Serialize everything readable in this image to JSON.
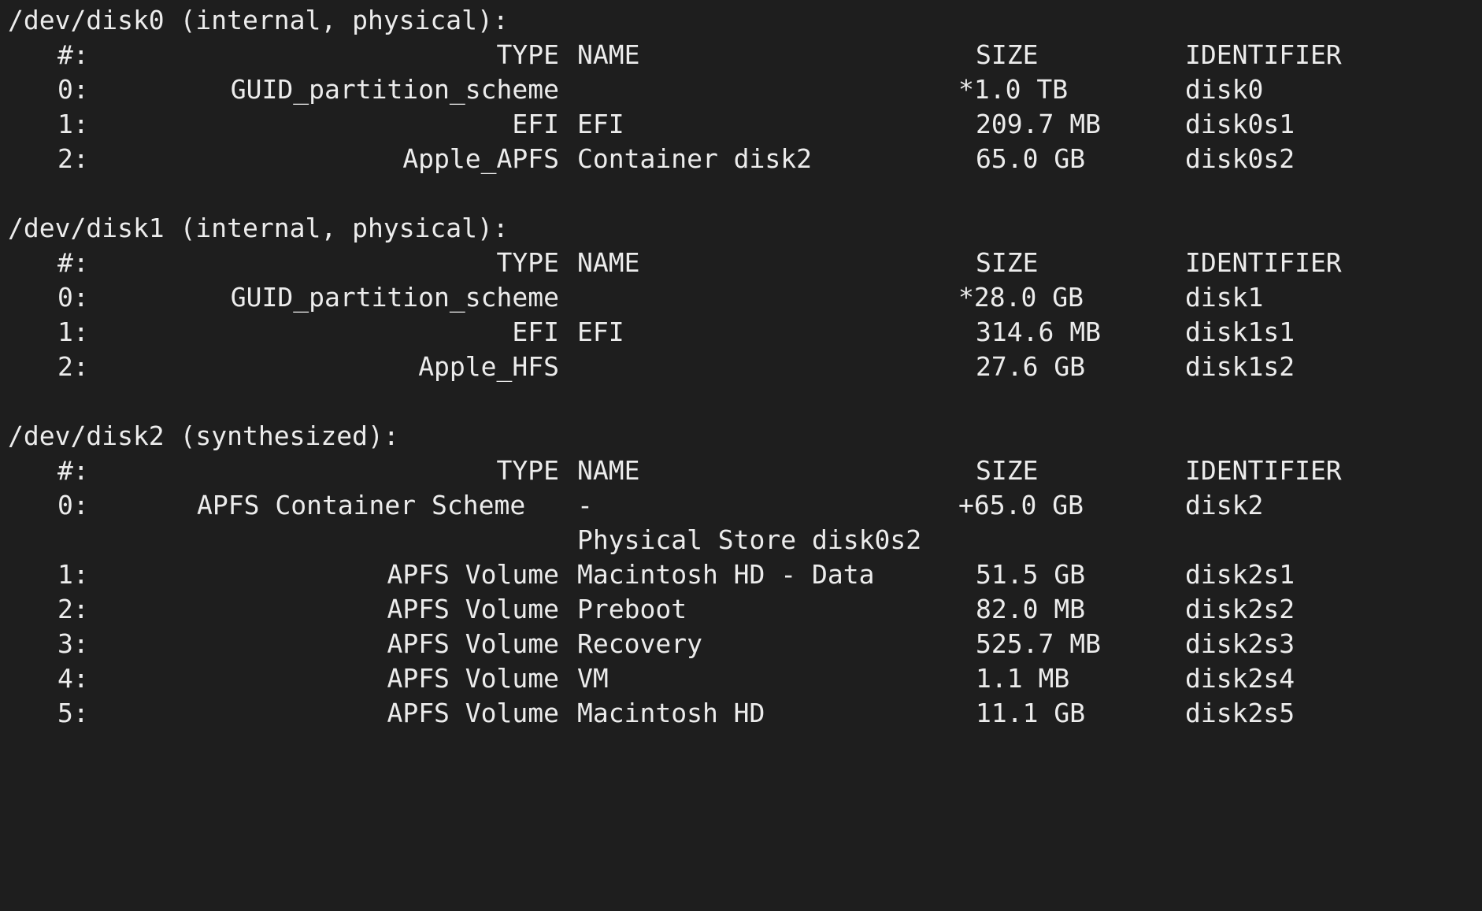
{
  "terminal": {
    "disks": [
      {
        "header": "/dev/disk0 (internal, physical):",
        "columns": {
          "num": "#:",
          "type": "TYPE",
          "name": "NAME",
          "size": "SIZE",
          "identifier": "IDENTIFIER"
        },
        "rows": [
          {
            "num": "0:",
            "type": "GUID_partition_scheme",
            "name": "",
            "size": "*1.0 TB",
            "identifier": "disk0"
          },
          {
            "num": "1:",
            "type": "EFI",
            "name": "EFI",
            "size": "209.7 MB",
            "identifier": "disk0s1"
          },
          {
            "num": "2:",
            "type": "Apple_APFS",
            "name": "Container disk2",
            "size": "65.0 GB",
            "identifier": "disk0s2"
          }
        ]
      },
      {
        "header": "/dev/disk1 (internal, physical):",
        "columns": {
          "num": "#:",
          "type": "TYPE",
          "name": "NAME",
          "size": "SIZE",
          "identifier": "IDENTIFIER"
        },
        "rows": [
          {
            "num": "0:",
            "type": "GUID_partition_scheme",
            "name": "",
            "size": "*28.0 GB",
            "identifier": "disk1"
          },
          {
            "num": "1:",
            "type": "EFI",
            "name": "EFI",
            "size": "314.6 MB",
            "identifier": "disk1s1"
          },
          {
            "num": "2:",
            "type": "Apple_HFS",
            "name": "",
            "size": "27.6 GB",
            "identifier": "disk1s2"
          }
        ]
      },
      {
        "header": "/dev/disk2 (synthesized):",
        "columns": {
          "num": "#:",
          "type": "TYPE",
          "name": "NAME",
          "size": "SIZE",
          "identifier": "IDENTIFIER"
        },
        "rows": [
          {
            "num": "0:",
            "type": "APFS Container Scheme",
            "name": "-",
            "size": "+65.0 GB",
            "identifier": "disk2"
          },
          {
            "num": "",
            "type": "",
            "name": "Physical Store disk0s2",
            "size": "",
            "identifier": ""
          },
          {
            "num": "1:",
            "type": "APFS Volume",
            "name": "Macintosh HD - Data",
            "size": "51.5 GB",
            "identifier": "disk2s1"
          },
          {
            "num": "2:",
            "type": "APFS Volume",
            "name": "Preboot",
            "size": "82.0 MB",
            "identifier": "disk2s2"
          },
          {
            "num": "3:",
            "type": "APFS Volume",
            "name": "Recovery",
            "size": "525.7 MB",
            "identifier": "disk2s3"
          },
          {
            "num": "4:",
            "type": "APFS Volume",
            "name": "VM",
            "size": "1.1 MB",
            "identifier": "disk2s4"
          },
          {
            "num": "5:",
            "type": "APFS Volume",
            "name": "Macintosh HD",
            "size": "11.1 GB",
            "identifier": "disk2s5"
          }
        ]
      }
    ]
  },
  "colors": {
    "background": "#1e1e1e",
    "text": "#ececec"
  }
}
